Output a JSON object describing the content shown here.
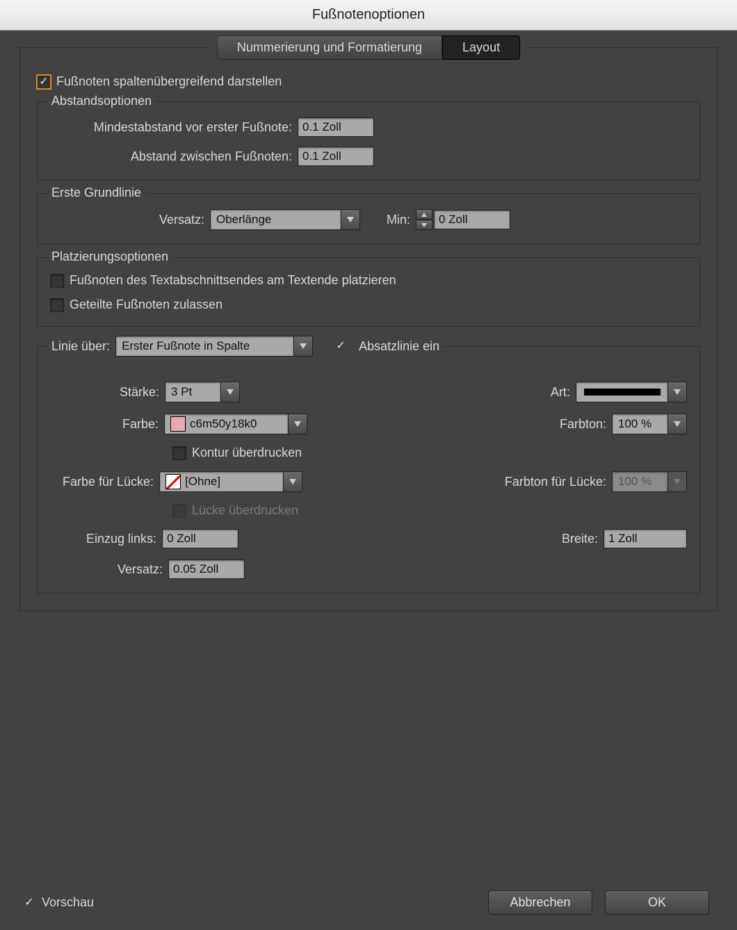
{
  "title": "Fußnotenoptionen",
  "tabs": {
    "numbering": "Nummerierung und Formatierung",
    "layout": "Layout"
  },
  "span_columns_label": "Fußnoten spaltenübergreifend darstellen",
  "spacing": {
    "legend": "Abstandsoptionen",
    "min_before_label": "Mindestabstand vor erster Fußnote:",
    "min_before_value": "0.1 Zoll",
    "between_label": "Abstand zwischen Fußnoten:",
    "between_value": "0.1 Zoll"
  },
  "baseline": {
    "legend": "Erste Grundlinie",
    "offset_label": "Versatz:",
    "offset_value": "Oberlänge",
    "min_label": "Min:",
    "min_value": "0 Zoll"
  },
  "placement": {
    "legend": "Platzierungsoptionen",
    "end_of_story_label": "Fußnoten des Textabschnittsendes am Textende platzieren",
    "split_label": "Geteilte Fußnoten zulassen"
  },
  "rule": {
    "rule_above_label": "Linie über:",
    "rule_above_value": "Erster Fußnote in Spalte",
    "rule_on_label": "Absatzlinie ein",
    "weight_label": "Stärke:",
    "weight_value": "3 Pt",
    "type_label": "Art:",
    "color_label": "Farbe:",
    "color_value": "c6m50y18k0",
    "color_hex": "#e8a9b5",
    "tint_label": "Farbton:",
    "tint_value": "100 %",
    "overprint_stroke_label": "Kontur überdrucken",
    "gap_color_label": "Farbe für Lücke:",
    "gap_color_value": "[Ohne]",
    "gap_tint_label": "Farbton für Lücke:",
    "gap_tint_value": "100 %",
    "overprint_gap_label": "Lücke überdrucken",
    "left_indent_label": "Einzug links:",
    "left_indent_value": "0 Zoll",
    "width_label": "Breite:",
    "width_value": "1 Zoll",
    "offset_label": "Versatz:",
    "offset_value": "0.05 Zoll"
  },
  "preview_label": "Vorschau",
  "cancel_label": "Abbrechen",
  "ok_label": "OK"
}
